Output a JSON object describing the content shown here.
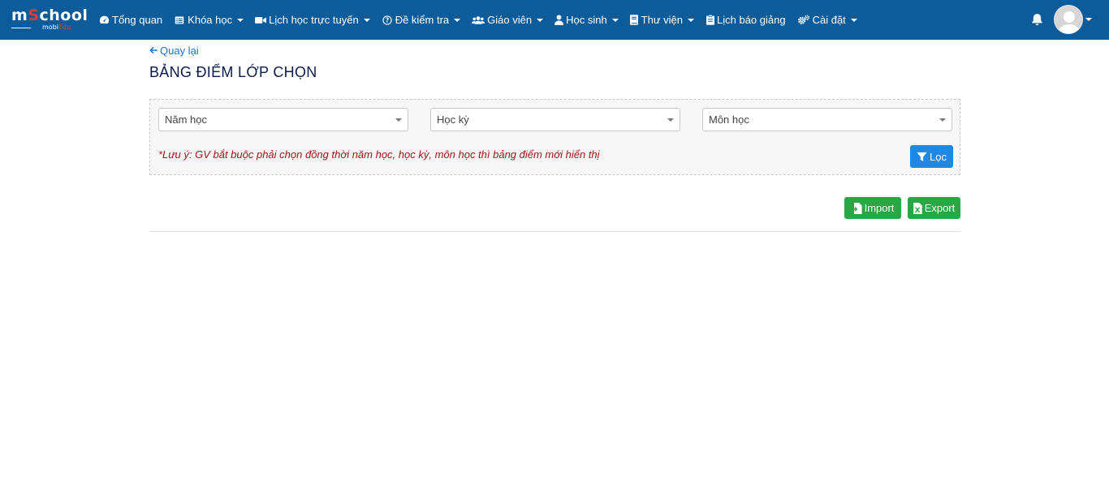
{
  "brand": {
    "logo_main_a": "m",
    "logo_main_o": "S",
    "logo_main_b": "chool",
    "logo_sub_a": "mobi",
    "logo_sub_b": "Edu"
  },
  "nav": [
    {
      "label": "Tổng quan",
      "icon": "dashboard-icon",
      "caret": false
    },
    {
      "label": "Khóa học",
      "icon": "list-icon",
      "caret": true
    },
    {
      "label": "Lịch học trực tuyến",
      "icon": "video-icon",
      "caret": true
    },
    {
      "label": "Đề kiểm tra",
      "icon": "question-icon",
      "caret": true
    },
    {
      "label": "Giáo viên",
      "icon": "users-icon",
      "caret": true
    },
    {
      "label": "Học sinh",
      "icon": "user-icon",
      "caret": true
    },
    {
      "label": "Thư viện",
      "icon": "book-icon",
      "caret": true
    },
    {
      "label": "Lịch báo giảng",
      "icon": "clipboard-icon",
      "caret": false
    },
    {
      "label": "Cài đặt",
      "icon": "cogs-icon",
      "caret": true
    }
  ],
  "back": {
    "label": "Quay lại"
  },
  "page": {
    "title": "BẢNG ĐIỂM LỚP CHỌN"
  },
  "filters": {
    "school_year": {
      "placeholder": "Năm học"
    },
    "semester": {
      "placeholder": "Học kỳ"
    },
    "subject": {
      "placeholder": "Môn học"
    },
    "note": "*Lưu ý: GV bắt buộc phải chọn đồng thời năm học, học kỳ, môn học thì bảng điểm mới hiển thị",
    "filter_button": "Lọc"
  },
  "actions": {
    "import_label": "Import",
    "export_label": "Export"
  },
  "colors": {
    "navbar": "#0c5c9c",
    "primary": "#1e88e5",
    "success": "#28a745",
    "title": "#0d1b4c",
    "note": "#a01515"
  }
}
